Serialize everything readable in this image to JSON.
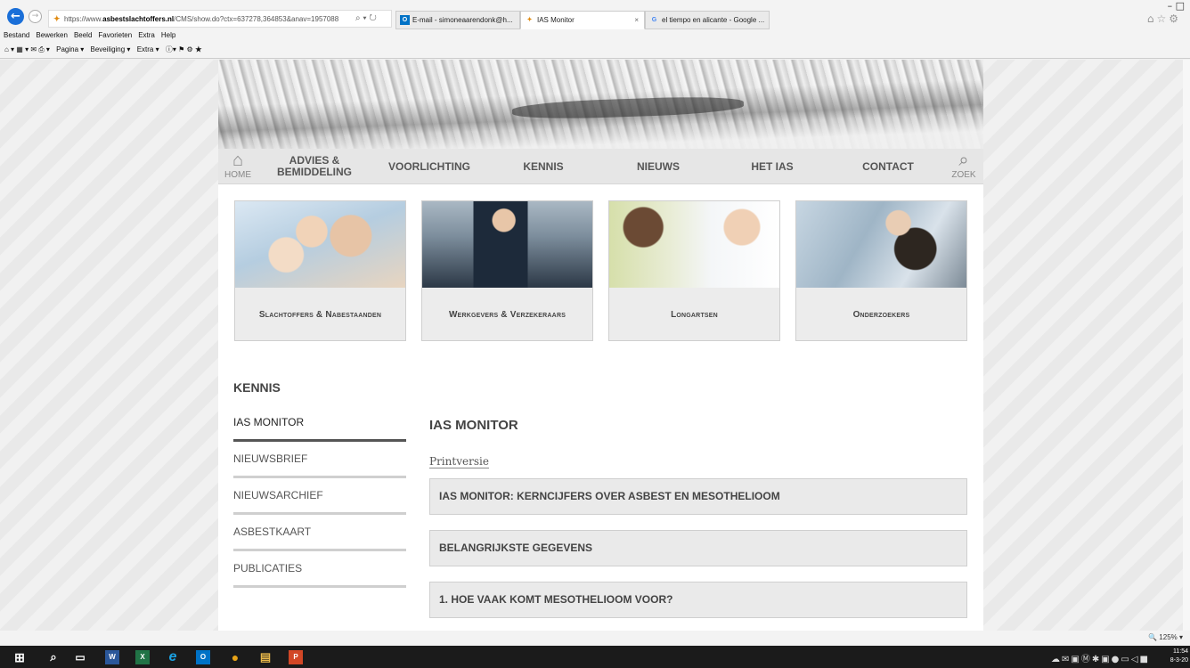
{
  "browser": {
    "address": {
      "prefix": "https://www.",
      "domain": "asbestslachtoffers.nl",
      "path": "/CMS/show.do?ctx=637278,364853&anav=1957088",
      "tools": "⌕ ▾ ↻"
    },
    "tabs": [
      {
        "label": "E-mail - simoneaarendonk@h...",
        "icon": "outlook-icon",
        "icon_text": "O",
        "active": false
      },
      {
        "label": "IAS Monitor",
        "icon": "ias-favicon-icon",
        "icon_text": "✦",
        "active": true,
        "close": "×"
      },
      {
        "label": "el tiempo en alicante - Google ...",
        "icon": "google-icon",
        "icon_text": "G",
        "active": false
      }
    ],
    "window_controls": "–  □",
    "right_icons": "⌂☆⚙",
    "back": "←",
    "forward": "→"
  },
  "menubar": [
    "Bestand",
    "Bewerken",
    "Beeld",
    "Favorieten",
    "Extra",
    "Help"
  ],
  "cmdbar": {
    "icons_before": "⌂ ▾  ▦ ▾  ✉  ⎙ ▾",
    "items": [
      "Pagina ▾",
      "Beveiliging ▾",
      "Extra ▾"
    ],
    "icons_after": "ⓘ▾ ⚑ ⚙ ★"
  },
  "nav": {
    "home_icon": "⌂",
    "home_label": "HOME",
    "items": [
      {
        "line1": "ADVIES &",
        "line2": "BEMIDDELING"
      },
      {
        "line1": "VOORLICHTING"
      },
      {
        "line1": "KENNIS"
      },
      {
        "line1": "NIEUWS"
      },
      {
        "line1": "HET IAS"
      },
      {
        "line1": "CONTACT"
      }
    ],
    "search_icon": "⌕",
    "search_label": "ZOEK"
  },
  "cards": [
    {
      "label": "Slachtoffers & Nabestaanden"
    },
    {
      "label": "Werkgevers & Verzekeraars"
    },
    {
      "label": "Longartsen"
    },
    {
      "label": "Onderzoekers"
    }
  ],
  "section": {
    "title": "KENNIS",
    "sidenav": [
      {
        "label": "IAS MONITOR",
        "active": true
      },
      {
        "label": "NIEUWSBRIEF",
        "active": false
      },
      {
        "label": "NIEUWSARCHIEF",
        "active": false
      },
      {
        "label": "ASBESTKAART",
        "active": false
      },
      {
        "label": "PUBLICATIES",
        "active": false
      }
    ]
  },
  "content": {
    "title": "IAS MONITOR",
    "print_link": "Printversie",
    "accordions": [
      "IAS MONITOR: KERNCIJFERS OVER ASBEST EN MESOTHELIOOM",
      "BELANGRIJKSTE GEGEVENS",
      "1. HOE VAAK KOMT MESOTHELIOOM VOOR?"
    ]
  },
  "status": {
    "zoom": "🔍 125%  ▾"
  },
  "taskbar": {
    "clock_time": "11:54",
    "clock_date": "8-3-20",
    "tray": "☁✉▣Ⓜ✱▣●▭◁■",
    "apps": [
      {
        "name": "windows-start-icon",
        "glyph": "⊞",
        "color": "#1b1b1b"
      },
      {
        "name": "search-icon",
        "glyph": "⌕",
        "color": "#1b1b1b"
      },
      {
        "name": "task-view-icon",
        "glyph": "▭",
        "color": "#1b1b1b"
      },
      {
        "name": "word-icon",
        "glyph": "W",
        "color": "#2b579a"
      },
      {
        "name": "excel-icon",
        "glyph": "X",
        "color": "#217346"
      },
      {
        "name": "internet-explorer-icon",
        "glyph": "e",
        "color": "#1ba1e2"
      },
      {
        "name": "outlook-icon",
        "glyph": "O",
        "color": "#0072c6"
      },
      {
        "name": "chrome-icon",
        "glyph": "●",
        "color": "#e8a317"
      },
      {
        "name": "file-explorer-icon",
        "glyph": "▤",
        "color": "#e8b84a"
      },
      {
        "name": "powerpoint-icon",
        "glyph": "P",
        "color": "#d24726"
      }
    ]
  },
  "colors": {
    "accent": "#1a6fd8",
    "nav_bg": "#e6e6e6",
    "card_bg": "#ececec",
    "active_bar": "#555555"
  }
}
